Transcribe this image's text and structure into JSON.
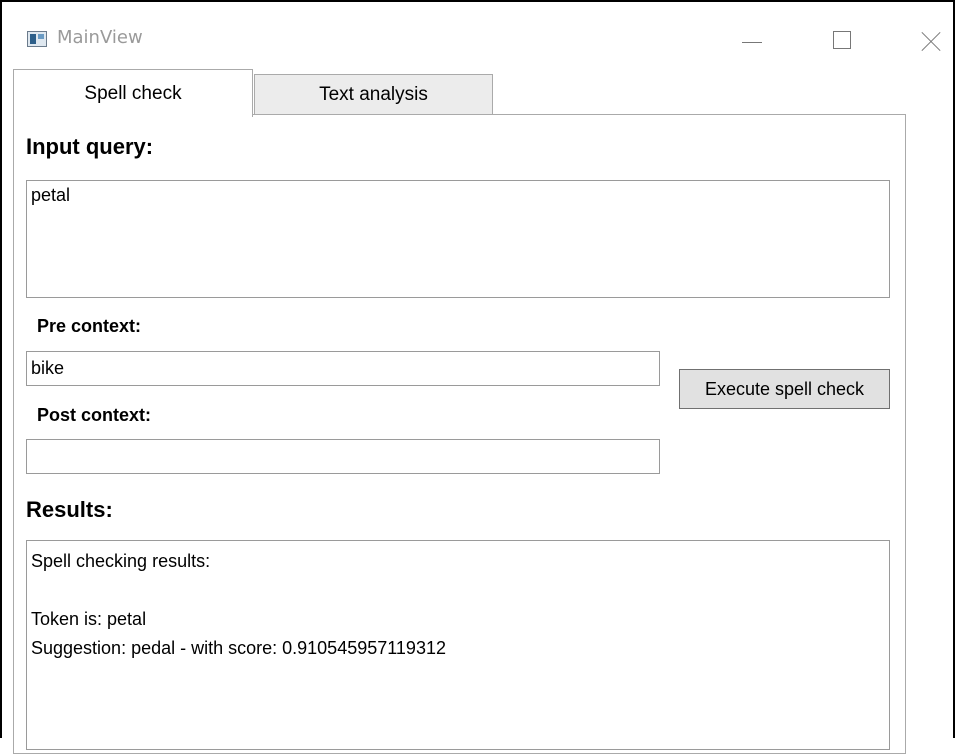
{
  "window": {
    "title": "MainView",
    "controls": [
      "minimize-icon",
      "maximize-icon",
      "close-icon"
    ]
  },
  "tabs": [
    {
      "label": "Spell check",
      "selected": true
    },
    {
      "label": "Text analysis",
      "selected": false
    }
  ],
  "spell_check": {
    "input_label": "Input query:",
    "input_value": "petal",
    "pre_context_label": "Pre context:",
    "pre_context_value": "bike",
    "post_context_label": "Post context:",
    "post_context_value": "",
    "execute_label": "Execute spell check",
    "results_label": "Results:",
    "results_lines": [
      "Spell checking results:",
      "",
      "Token is: petal",
      "Suggestion: pedal - with score: 0.910545957119312"
    ]
  }
}
